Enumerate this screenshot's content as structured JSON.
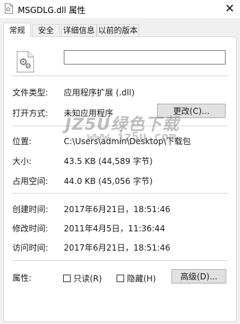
{
  "window": {
    "title": "MSGDLG.dll 属性",
    "close_glyph": "✕"
  },
  "tabs": [
    "常规",
    "安全",
    "详细信息",
    "以前的版本"
  ],
  "general": {
    "file_name_value": "",
    "file_type": {
      "label": "文件类型:",
      "value": "应用程序扩展 (.dll)"
    },
    "open_with": {
      "label": "打开方式:",
      "value": "未知应用程序",
      "button": "更改(C)..."
    },
    "location": {
      "label": "位置:",
      "value": "C:\\Users\\admin\\Desktop\\下载包"
    },
    "size": {
      "label": "大小:",
      "value": "43.5 KB (44,589 字节)"
    },
    "size_on_disk": {
      "label": "占用空间:",
      "value": "44.0 KB (45,056 字节)"
    },
    "created": {
      "label": "创建时间:",
      "value": "2017年6月21日，18:51:46"
    },
    "modified": {
      "label": "修改时间:",
      "value": "2011年4月5日，11:36:44"
    },
    "accessed": {
      "label": "访问时间:",
      "value": "2017年6月21日，18:51:46"
    },
    "attributes": {
      "label": "属性:",
      "readonly": "只读(R)",
      "hidden": "隐藏(H)",
      "advanced_button": "高级(D)..."
    }
  },
  "watermark": {
    "main": "JZ5U绿色下载",
    "sub": "www.jz5u.com"
  },
  "icons": {
    "title_icon": "file-gear-icon",
    "file_icon": "dll-file-gear-icon",
    "close": "close-icon"
  }
}
